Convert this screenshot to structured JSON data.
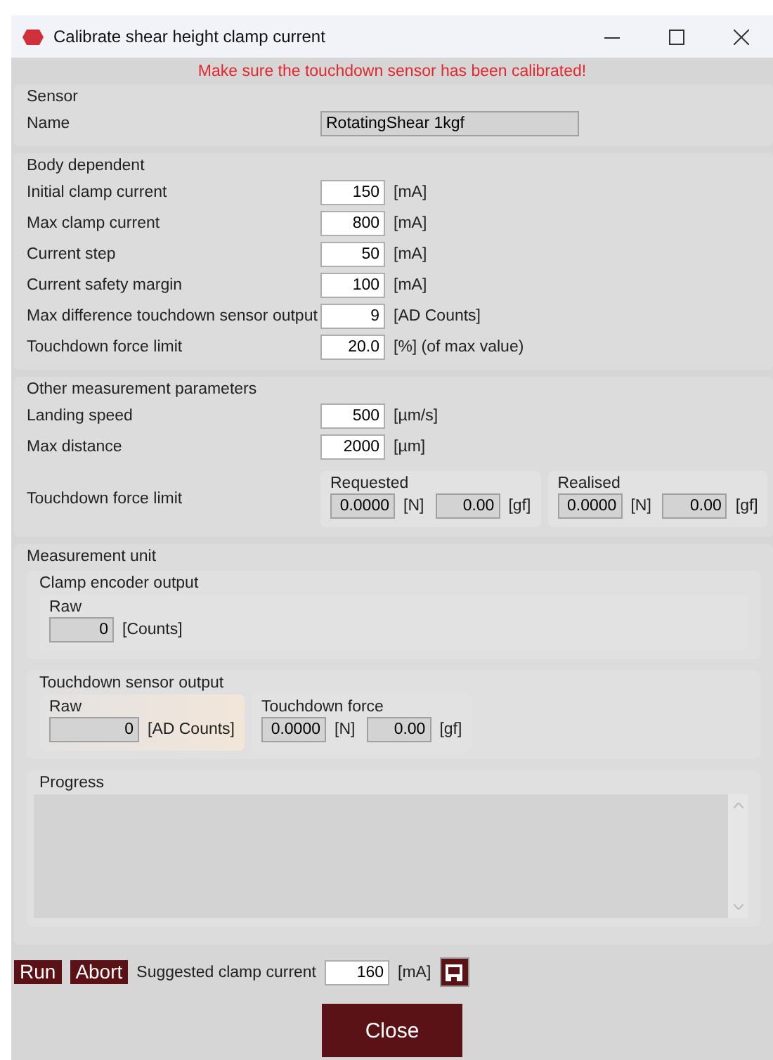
{
  "window": {
    "title": "Calibrate shear height clamp current"
  },
  "warning": "Make sure the touchdown sensor has been calibrated!",
  "sections": [
    {
      "title": "Sensor",
      "rows": [
        {
          "kind": "text",
          "label": "Name",
          "value": "RotatingShear 1kgf",
          "readonly": true
        }
      ]
    },
    {
      "title": "Body dependent",
      "rows": [
        {
          "kind": "number",
          "label": "Initial clamp current",
          "value": "150",
          "unit": "[mA]",
          "readonly": false
        },
        {
          "kind": "number",
          "label": "Max clamp current",
          "value": "800",
          "unit": "[mA]",
          "readonly": false
        },
        {
          "kind": "number",
          "label": "Current step",
          "value": "50",
          "unit": "[mA]",
          "readonly": false
        },
        {
          "kind": "number",
          "label": "Current safety margin",
          "value": "100",
          "unit": "[mA]",
          "readonly": false
        },
        {
          "kind": "number",
          "label": "Max difference touchdown sensor output",
          "value": "9",
          "unit": "[AD Counts]",
          "readonly": false
        },
        {
          "kind": "number",
          "label": "Touchdown force limit",
          "value": "20.0",
          "unit": "[%] (of max value)",
          "readonly": false
        }
      ]
    },
    {
      "title": "Other measurement parameters",
      "rows": [
        {
          "kind": "number",
          "label": "Landing speed",
          "value": "500",
          "unit": "[µm/s]",
          "readonly": false
        },
        {
          "kind": "number",
          "label": "Max distance",
          "value": "2000",
          "unit": "[µm]",
          "readonly": false
        },
        {
          "kind": "groups",
          "label": "Touchdown force limit",
          "groups": [
            {
              "title": "Requested",
              "highlighted": false,
              "fields": [
                {
                  "value": "0.0000",
                  "unit": "[N]"
                },
                {
                  "value": "0.00",
                  "unit": "[gf]"
                }
              ]
            },
            {
              "title": "Realised",
              "highlighted": false,
              "fields": [
                {
                  "value": "0.0000",
                  "unit": "[N]"
                },
                {
                  "value": "0.00",
                  "unit": "[gf]"
                }
              ]
            }
          ]
        }
      ]
    }
  ],
  "measurement_unit": {
    "title": "Measurement unit",
    "subsections": [
      {
        "title": "Clamp encoder output",
        "groups": [
          {
            "title": "Raw",
            "highlighted": false,
            "fields": [
              {
                "value": "0",
                "unit": "[Counts]"
              }
            ]
          }
        ]
      },
      {
        "title": "Touchdown sensor output",
        "groups": [
          {
            "title": "Raw",
            "highlighted": true,
            "fields": [
              {
                "value": "0",
                "unit": "[AD Counts]",
                "wide": true
              }
            ]
          },
          {
            "title": "Touchdown force",
            "highlighted": false,
            "fields": [
              {
                "value": "0.0000",
                "unit": "[N]"
              },
              {
                "value": "0.00",
                "unit": "[gf]"
              }
            ]
          }
        ]
      }
    ],
    "progress": {
      "title": "Progress"
    }
  },
  "actions": {
    "buttons": [
      "Run",
      "Abort"
    ],
    "suggested": {
      "label": "Suggested clamp current",
      "value": "160",
      "unit": "[mA]"
    }
  },
  "close_button": "Close"
}
